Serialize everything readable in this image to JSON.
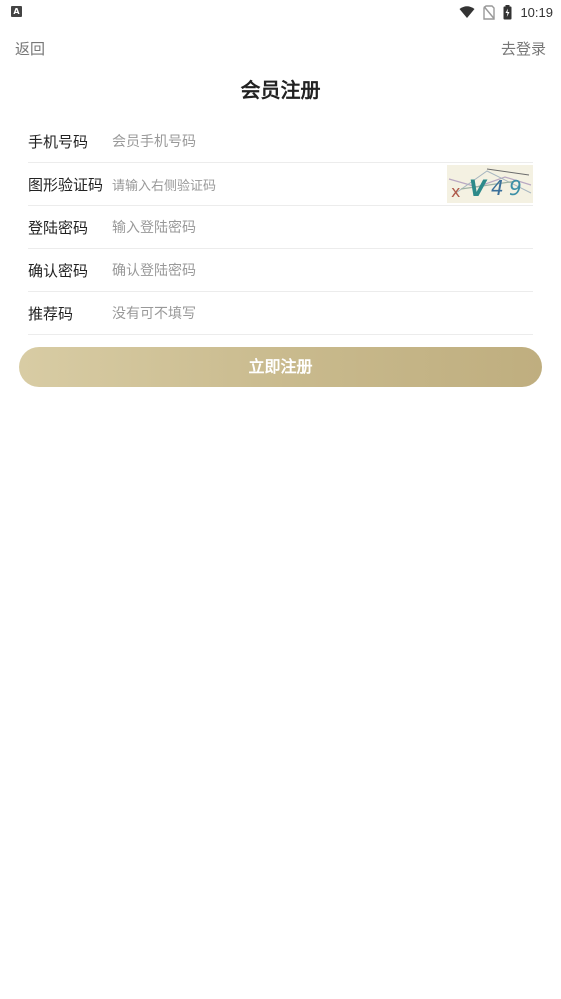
{
  "status_bar": {
    "left_icon": "A",
    "time": "10:19",
    "icons": [
      "wifi-icon",
      "no-sim-icon",
      "battery-charging-icon"
    ]
  },
  "nav": {
    "back_label": "返回",
    "login_label": "去登录"
  },
  "page": {
    "title": "会员注册"
  },
  "form": {
    "phone": {
      "label": "手机号码",
      "placeholder": "会员手机号码"
    },
    "captcha": {
      "label": "图形验证码",
      "placeholder": "请输入右侧验证码",
      "image_text": "xV49"
    },
    "password": {
      "label": "登陆密码",
      "placeholder": "输入登陆密码"
    },
    "confirm": {
      "label": "确认密码",
      "placeholder": "确认登陆密码"
    },
    "referral": {
      "label": "推荐码",
      "placeholder": "没有可不填写"
    }
  },
  "submit": {
    "label": "立即注册"
  },
  "colors": {
    "button_gradient_start": "#d8cca4",
    "button_gradient_end": "#bfae7f",
    "placeholder": "#999999",
    "label": "#222222",
    "nav_link": "#777777"
  }
}
